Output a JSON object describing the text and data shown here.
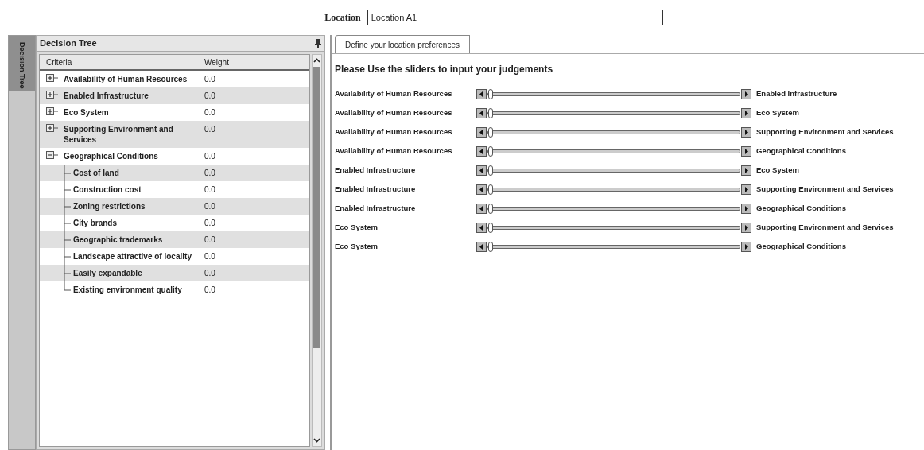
{
  "location": {
    "label": "Location",
    "value": "Location A1"
  },
  "side_tab": {
    "label": "Decision Tree",
    "selected": true
  },
  "panel": {
    "title": "Decision Tree"
  },
  "tree": {
    "columns": [
      "Criteria",
      "Weight"
    ],
    "rows": [
      {
        "name": "Availability of Human Resources",
        "weight": "0.0",
        "expanded": false
      },
      {
        "name": "Enabled Infrastructure",
        "weight": "0.0",
        "expanded": false
      },
      {
        "name": "Eco System",
        "weight": "0.0",
        "expanded": false
      },
      {
        "name": "Supporting Environment and Services",
        "weight": "0.0",
        "expanded": false
      },
      {
        "name": "Geographical Conditions",
        "weight": "0.0",
        "expanded": true,
        "children": [
          {
            "name": "Cost of land",
            "weight": "0.0"
          },
          {
            "name": "Construction cost",
            "weight": "0.0"
          },
          {
            "name": "Zoning restrictions",
            "weight": "0.0"
          },
          {
            "name": "City brands",
            "weight": "0.0"
          },
          {
            "name": "Geographic trademarks",
            "weight": "0.0"
          },
          {
            "name": "Landscape attractive of locality",
            "weight": "0.0"
          },
          {
            "name": "Easily expandable",
            "weight": "0.0"
          },
          {
            "name": "Existing environment quality",
            "weight": "0.0"
          }
        ]
      }
    ]
  },
  "tabs": [
    {
      "label": "Define your location preferences",
      "selected": true
    }
  ],
  "heading": "Please Use the sliders to input your judgements",
  "comparisons": [
    {
      "left": "Availability of Human Resources",
      "right": "Enabled Infrastructure",
      "level": 0
    },
    {
      "left": "Availability of Human Resources",
      "right": "Eco System",
      "level": 0
    },
    {
      "left": "Availability of Human Resources",
      "right": "Supporting Environment and Services",
      "level": 0
    },
    {
      "left": "Availability of Human Resources",
      "right": "Geographical Conditions",
      "level": 0
    },
    {
      "left": "Enabled Infrastructure",
      "right": "Eco System",
      "level": 0
    },
    {
      "left": "Enabled Infrastructure",
      "right": "Supporting Environment and Services",
      "level": 0
    },
    {
      "left": "Enabled Infrastructure",
      "right": "Geographical Conditions",
      "level": 0
    },
    {
      "left": "Eco System",
      "right": "Supporting Environment and Services",
      "level": 0
    },
    {
      "left": "Eco System",
      "right": "Geographical Conditions",
      "level": 0
    }
  ]
}
